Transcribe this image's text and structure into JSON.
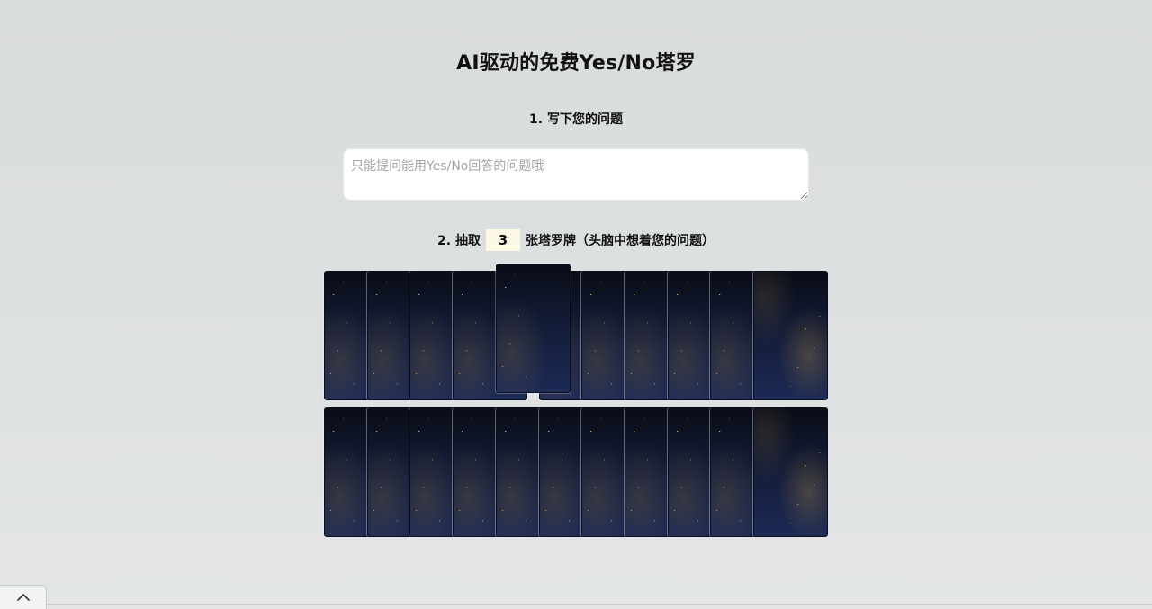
{
  "page": {
    "title": "AI驱动的免费Yes/No塔罗"
  },
  "step1": {
    "label": "1. 写下您的问题",
    "question_value": "",
    "question_placeholder": "只能提问能用Yes/No回答的问题哦"
  },
  "step2": {
    "prefix": "2. 抽取",
    "count": "3",
    "suffix": "张塔罗牌（头脑中想着您的问题）"
  },
  "deck": {
    "rows": 2,
    "cards_per_row": 11,
    "selected_card": {
      "row": 1,
      "index": 4
    },
    "card_back_icon": "starry-card-back",
    "colors": {
      "card_dark": "#0a0d17",
      "card_blue": "#1c2a55",
      "gold_speck": "#e6be6e",
      "count_bg": "#fdf8e6"
    }
  },
  "footer": {
    "toggle_icon": "chevron-up-icon"
  }
}
